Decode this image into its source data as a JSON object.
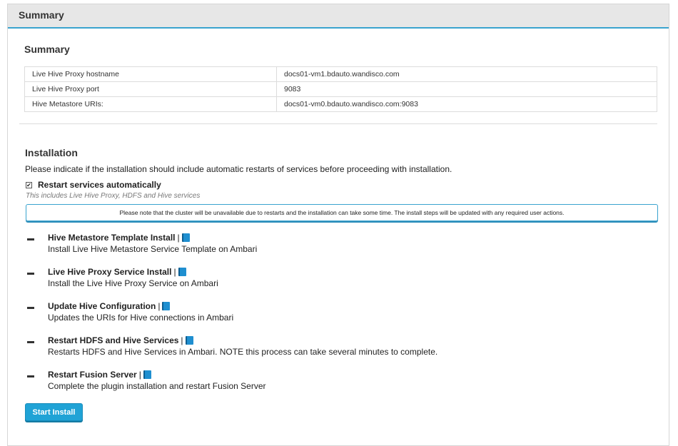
{
  "header": {
    "title": "Summary"
  },
  "summary": {
    "title": "Summary",
    "rows": [
      {
        "key": "Live Hive Proxy hostname",
        "value": "docs01-vm1.bdauto.wandisco.com"
      },
      {
        "key": "Live Hive Proxy port",
        "value": "9083"
      },
      {
        "key": "Hive Metastore URIs:",
        "value": "docs01-vm0.bdauto.wandisco.com:9083"
      }
    ]
  },
  "installation": {
    "title": "Installation",
    "instructions": "Please indicate if the installation should include automatic restarts of services before proceeding with installation.",
    "restart_checkbox": {
      "checked": true,
      "mark": "✔",
      "label": "Restart services automatically"
    },
    "restart_hint": "This includes Live Hive Proxy, HDFS and Hive services",
    "notice": "Please note that the cluster will be unavailable due to restarts and the installation can take some time. The install steps will be updated with any required user actions.",
    "steps": [
      {
        "title": "Hive Metastore Template Install",
        "separator": "|",
        "icon": "book-icon",
        "description": "Install Live Hive Metastore Service Template on Ambari"
      },
      {
        "title": "Live Hive Proxy Service Install",
        "separator": "|",
        "icon": "book-icon",
        "description": "Install the Live Hive Proxy Service on Ambari"
      },
      {
        "title": "Update Hive Configuration",
        "separator": "|",
        "icon": "book-icon",
        "description": "Updates the URIs for Hive connections in Ambari"
      },
      {
        "title": "Restart HDFS and Hive Services",
        "separator": "|",
        "icon": "book-icon",
        "description": "Restarts HDFS and Hive Services in Ambari. NOTE this process can take several minutes to complete."
      },
      {
        "title": "Restart Fusion Server",
        "separator": "|",
        "icon": "book-icon",
        "description": "Complete the plugin installation and restart Fusion Server"
      }
    ],
    "start_button": "Start Install"
  },
  "colors": {
    "accent": "#3aa3cf",
    "button": "#20a3d6",
    "header_bg": "#e7e7e7"
  }
}
